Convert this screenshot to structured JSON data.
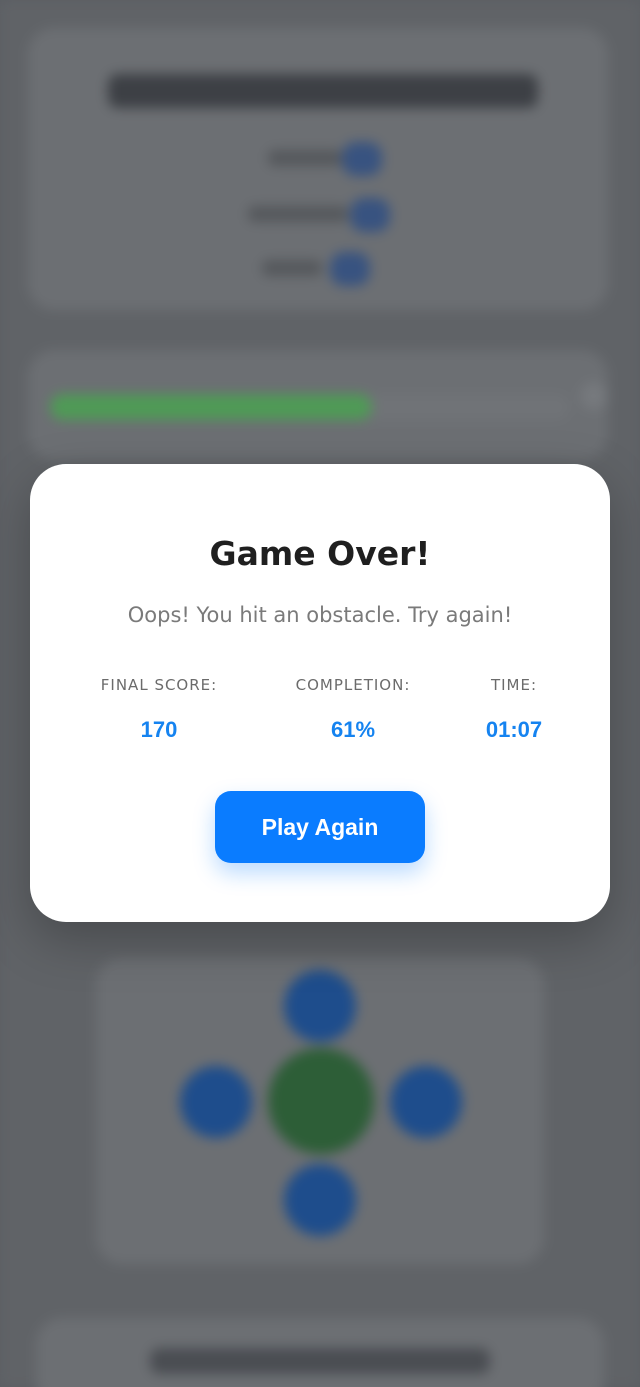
{
  "modal": {
    "title": "Game Over!",
    "message": "Oops! You hit an obstacle. Try again!",
    "stats": [
      {
        "label": "FINAL SCORE:",
        "value": "170"
      },
      {
        "label": "COMPLETION:",
        "value": "61%"
      },
      {
        "label": "TIME:",
        "value": "01:07"
      }
    ],
    "play_again_label": "Play Again"
  },
  "background": {
    "progress_fraction": 0.62,
    "colors": {
      "accent": "#0a7cff",
      "stat_value": "#1583f0",
      "progress_fill": "#4f9a56",
      "dpad_button": "#1e4d8c",
      "dpad_center": "#2d5e37"
    }
  }
}
